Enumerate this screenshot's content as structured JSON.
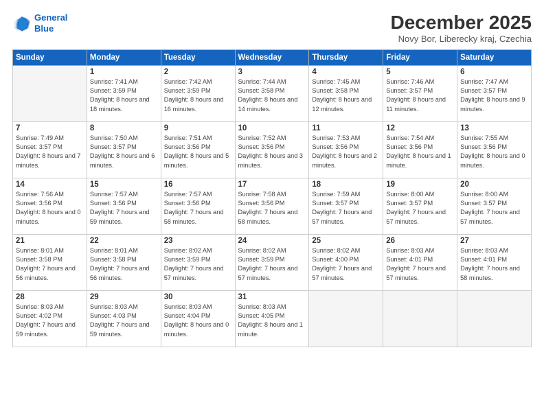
{
  "header": {
    "logo_line1": "General",
    "logo_line2": "Blue",
    "month": "December 2025",
    "location": "Novy Bor, Liberecky kraj, Czechia"
  },
  "days_of_week": [
    "Sunday",
    "Monday",
    "Tuesday",
    "Wednesday",
    "Thursday",
    "Friday",
    "Saturday"
  ],
  "weeks": [
    [
      {
        "day": "",
        "info": ""
      },
      {
        "day": "1",
        "info": "Sunrise: 7:41 AM\nSunset: 3:59 PM\nDaylight: 8 hours\nand 18 minutes."
      },
      {
        "day": "2",
        "info": "Sunrise: 7:42 AM\nSunset: 3:59 PM\nDaylight: 8 hours\nand 16 minutes."
      },
      {
        "day": "3",
        "info": "Sunrise: 7:44 AM\nSunset: 3:58 PM\nDaylight: 8 hours\nand 14 minutes."
      },
      {
        "day": "4",
        "info": "Sunrise: 7:45 AM\nSunset: 3:58 PM\nDaylight: 8 hours\nand 12 minutes."
      },
      {
        "day": "5",
        "info": "Sunrise: 7:46 AM\nSunset: 3:57 PM\nDaylight: 8 hours\nand 11 minutes."
      },
      {
        "day": "6",
        "info": "Sunrise: 7:47 AM\nSunset: 3:57 PM\nDaylight: 8 hours\nand 9 minutes."
      }
    ],
    [
      {
        "day": "7",
        "info": "Sunrise: 7:49 AM\nSunset: 3:57 PM\nDaylight: 8 hours\nand 7 minutes."
      },
      {
        "day": "8",
        "info": "Sunrise: 7:50 AM\nSunset: 3:57 PM\nDaylight: 8 hours\nand 6 minutes."
      },
      {
        "day": "9",
        "info": "Sunrise: 7:51 AM\nSunset: 3:56 PM\nDaylight: 8 hours\nand 5 minutes."
      },
      {
        "day": "10",
        "info": "Sunrise: 7:52 AM\nSunset: 3:56 PM\nDaylight: 8 hours\nand 3 minutes."
      },
      {
        "day": "11",
        "info": "Sunrise: 7:53 AM\nSunset: 3:56 PM\nDaylight: 8 hours\nand 2 minutes."
      },
      {
        "day": "12",
        "info": "Sunrise: 7:54 AM\nSunset: 3:56 PM\nDaylight: 8 hours\nand 1 minute."
      },
      {
        "day": "13",
        "info": "Sunrise: 7:55 AM\nSunset: 3:56 PM\nDaylight: 8 hours\nand 0 minutes."
      }
    ],
    [
      {
        "day": "14",
        "info": "Sunrise: 7:56 AM\nSunset: 3:56 PM\nDaylight: 8 hours\nand 0 minutes."
      },
      {
        "day": "15",
        "info": "Sunrise: 7:57 AM\nSunset: 3:56 PM\nDaylight: 7 hours\nand 59 minutes."
      },
      {
        "day": "16",
        "info": "Sunrise: 7:57 AM\nSunset: 3:56 PM\nDaylight: 7 hours\nand 58 minutes."
      },
      {
        "day": "17",
        "info": "Sunrise: 7:58 AM\nSunset: 3:56 PM\nDaylight: 7 hours\nand 58 minutes."
      },
      {
        "day": "18",
        "info": "Sunrise: 7:59 AM\nSunset: 3:57 PM\nDaylight: 7 hours\nand 57 minutes."
      },
      {
        "day": "19",
        "info": "Sunrise: 8:00 AM\nSunset: 3:57 PM\nDaylight: 7 hours\nand 57 minutes."
      },
      {
        "day": "20",
        "info": "Sunrise: 8:00 AM\nSunset: 3:57 PM\nDaylight: 7 hours\nand 57 minutes."
      }
    ],
    [
      {
        "day": "21",
        "info": "Sunrise: 8:01 AM\nSunset: 3:58 PM\nDaylight: 7 hours\nand 56 minutes."
      },
      {
        "day": "22",
        "info": "Sunrise: 8:01 AM\nSunset: 3:58 PM\nDaylight: 7 hours\nand 56 minutes."
      },
      {
        "day": "23",
        "info": "Sunrise: 8:02 AM\nSunset: 3:59 PM\nDaylight: 7 hours\nand 57 minutes."
      },
      {
        "day": "24",
        "info": "Sunrise: 8:02 AM\nSunset: 3:59 PM\nDaylight: 7 hours\nand 57 minutes."
      },
      {
        "day": "25",
        "info": "Sunrise: 8:02 AM\nSunset: 4:00 PM\nDaylight: 7 hours\nand 57 minutes."
      },
      {
        "day": "26",
        "info": "Sunrise: 8:03 AM\nSunset: 4:01 PM\nDaylight: 7 hours\nand 57 minutes."
      },
      {
        "day": "27",
        "info": "Sunrise: 8:03 AM\nSunset: 4:01 PM\nDaylight: 7 hours\nand 58 minutes."
      }
    ],
    [
      {
        "day": "28",
        "info": "Sunrise: 8:03 AM\nSunset: 4:02 PM\nDaylight: 7 hours\nand 59 minutes."
      },
      {
        "day": "29",
        "info": "Sunrise: 8:03 AM\nSunset: 4:03 PM\nDaylight: 7 hours\nand 59 minutes."
      },
      {
        "day": "30",
        "info": "Sunrise: 8:03 AM\nSunset: 4:04 PM\nDaylight: 8 hours\nand 0 minutes."
      },
      {
        "day": "31",
        "info": "Sunrise: 8:03 AM\nSunset: 4:05 PM\nDaylight: 8 hours\nand 1 minute."
      },
      {
        "day": "",
        "info": ""
      },
      {
        "day": "",
        "info": ""
      },
      {
        "day": "",
        "info": ""
      }
    ]
  ]
}
